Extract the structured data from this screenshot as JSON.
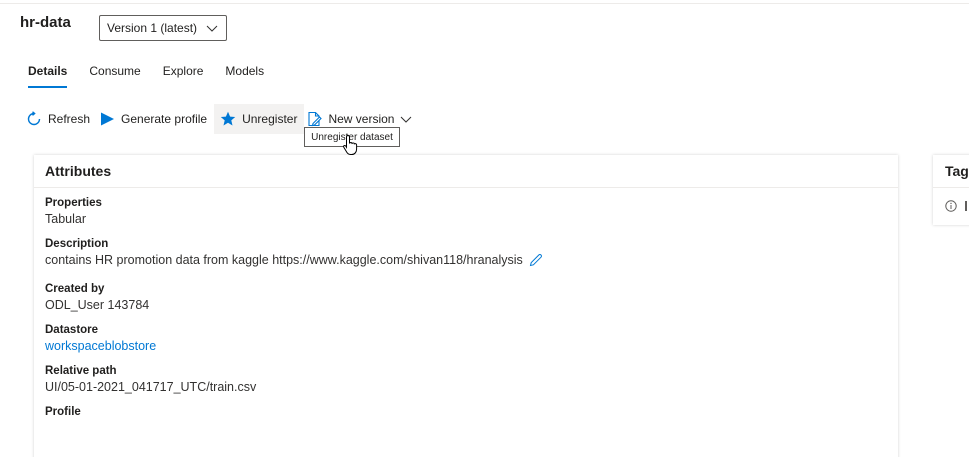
{
  "asset": {
    "title": "hr-data",
    "version_selected": "Version 1 (latest)"
  },
  "tabs": [
    {
      "label": "Details",
      "active": true
    },
    {
      "label": "Consume",
      "active": false
    },
    {
      "label": "Explore",
      "active": false
    },
    {
      "label": "Models",
      "active": false
    }
  ],
  "toolbar": {
    "refresh": "Refresh",
    "generate_profile": "Generate profile",
    "unregister": "Unregister",
    "new_version": "New version",
    "tooltip": "Unregister dataset"
  },
  "attributes": {
    "header": "Attributes",
    "properties_label": "Properties",
    "properties_value": "Tabular",
    "description_label": "Description",
    "description_value": "contains HR promotion data from kaggle https://www.kaggle.com/shivan118/hranalysis",
    "created_by_label": "Created by",
    "created_by_value": "ODL_User 143784",
    "datastore_label": "Datastore",
    "datastore_value": "workspaceblobstore",
    "relative_path_label": "Relative path",
    "relative_path_value": "UI/05-01-2021_041717_UTC/train.csv",
    "profile_label": "Profile"
  },
  "tags": {
    "header": "Tag"
  },
  "colors": {
    "accent": "#0078d4",
    "text": "#201f1e",
    "hover_bg": "#f3f2f1"
  },
  "icons": {
    "refresh": "refresh-icon",
    "generate_profile": "play-icon",
    "unregister": "star-icon",
    "new_version": "edit-document-icon",
    "edit": "pencil-icon",
    "info": "info-icon"
  }
}
